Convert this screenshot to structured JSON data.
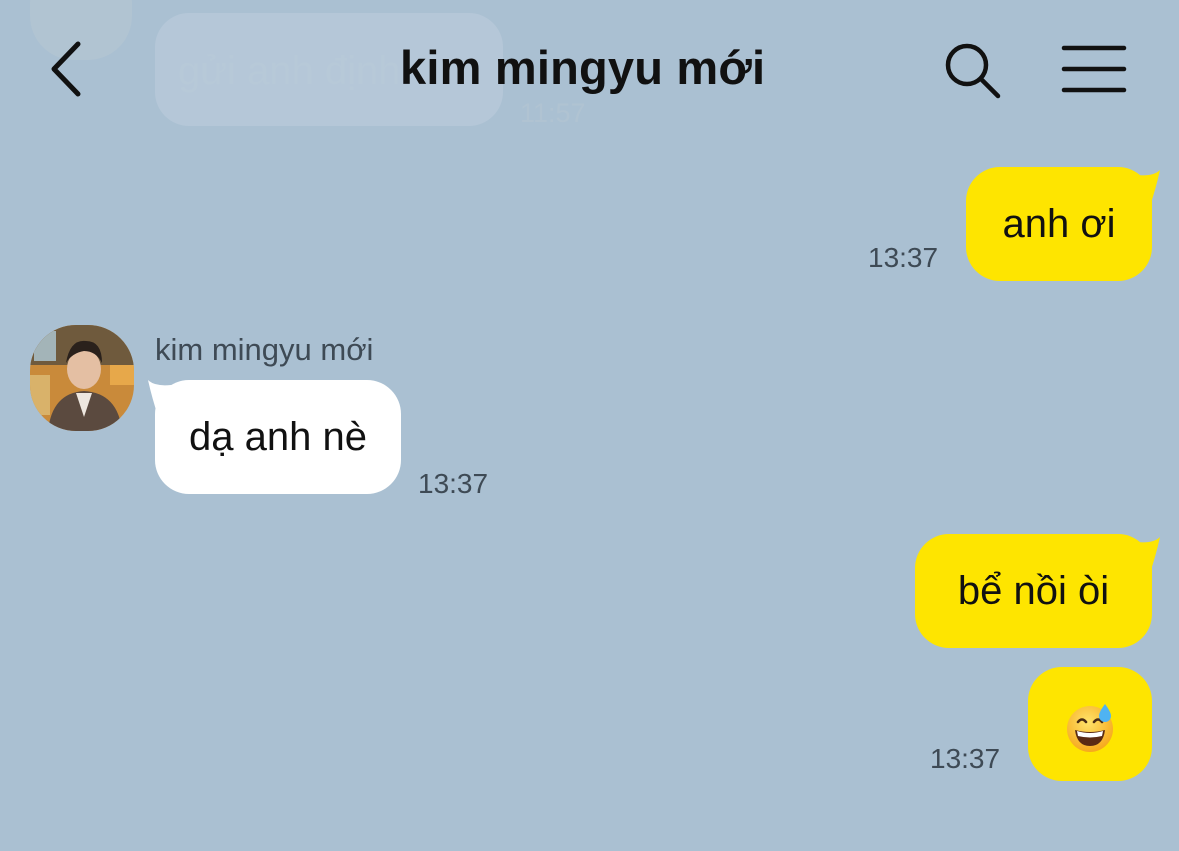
{
  "header": {
    "title": "kim mingyu mới",
    "back_icon": "chevron-left-icon",
    "search_icon": "search-icon",
    "menu_icon": "hamburger-menu-icon"
  },
  "faded_message": {
    "text": "gửi anh định vị",
    "time": "11:57"
  },
  "messages": [
    {
      "direction": "outgoing",
      "text": "anh ơi",
      "time": "13:37"
    },
    {
      "direction": "incoming",
      "sender": "kim mingyu mới",
      "text": "dạ anh nè",
      "time": "13:37"
    },
    {
      "direction": "outgoing",
      "text": "bể nồi òi"
    },
    {
      "direction": "outgoing",
      "emoji": "grinning-face-with-sweat-icon",
      "time": "13:37"
    }
  ],
  "colors": {
    "background": "#aac0d2",
    "outgoing_bubble": "#fee500",
    "incoming_bubble": "#ffffff"
  }
}
